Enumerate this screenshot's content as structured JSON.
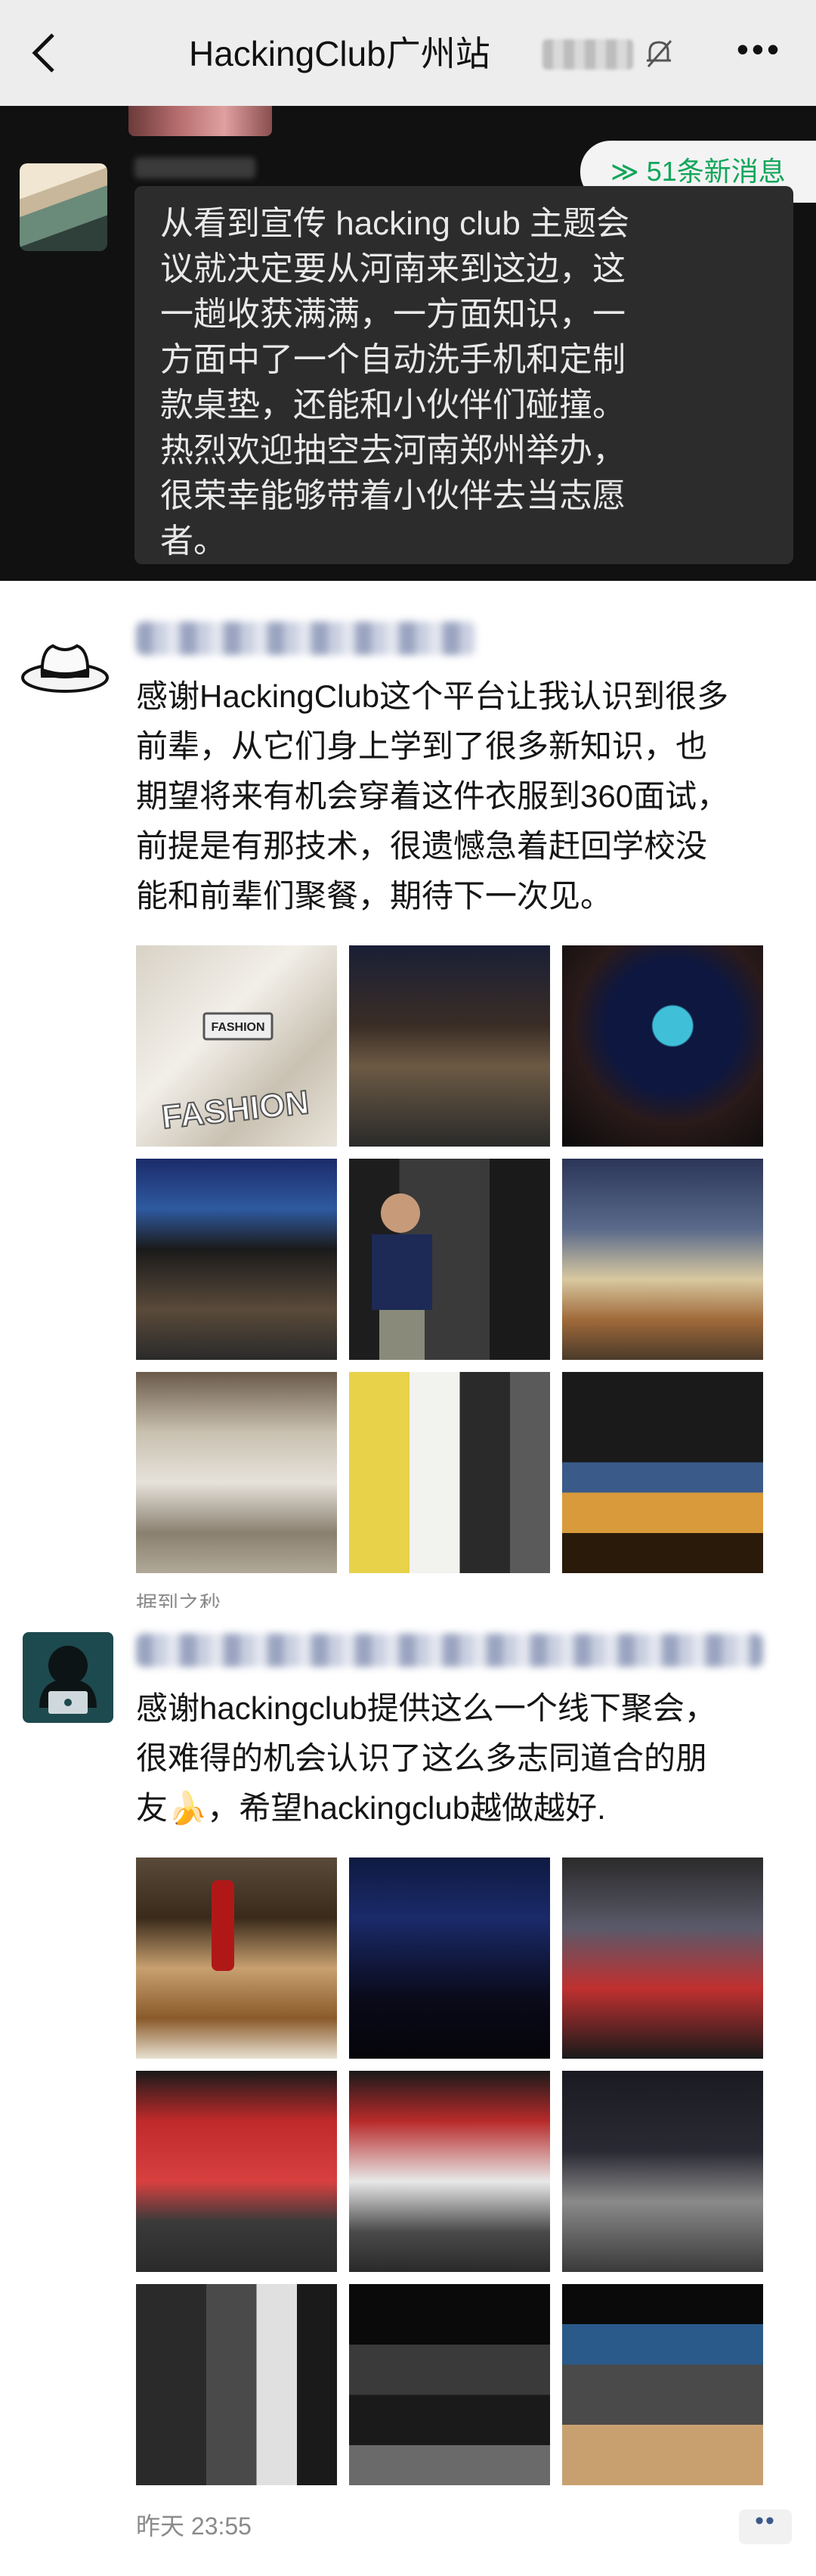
{
  "header": {
    "back_icon": "chevron-left-icon",
    "title": "HackingClub广州站",
    "mute_icon": "bell-off-icon",
    "more_label": "•••"
  },
  "chat": {
    "new_messages_arrow": "≫",
    "new_messages_label": "51条新消息",
    "message_lines": [
      "从看到宣传 hacking club 主题会",
      "议就决定要从河南来到这边，这",
      "一趟收获满满，一方面知识，一",
      "方面中了一个自动洗手机和定制",
      "款桌垫，还能和小伙伴们碰撞。",
      "热烈欢迎抽空去河南郑州举办，",
      "很荣幸能够带着小伙伴去当志愿",
      "者。"
    ]
  },
  "posts": [
    {
      "avatar_icon": "fedora-hat-icon",
      "text_lines": [
        "感谢HackingClub这个平台让我认识到很多",
        "前辈，从它们身上学到了很多新知识，也",
        "期望将来有机会穿着这件衣服到360面试，",
        "前提是有那技术，很遗憾急着赶回学校没",
        "能和前辈们聚餐，期待下一次见。"
      ],
      "tshirt_badge": "FASHION",
      "tshirt_print": "FASHION",
      "collapse_label": "据到之秒"
    },
    {
      "avatar_icon": "hacker-laptop-icon",
      "text_lines": [
        "感谢hackingclub提供这么一个线下聚会，",
        "很难得的机会认识了这么多志同道合的朋",
        "友🍌，希望hackingclub越做越好."
      ],
      "timestamp": "昨天 23:55",
      "comment_label": "••"
    }
  ],
  "colors": {
    "dark_background": "#111111",
    "bubble": "#2c2c2c",
    "new_messages_green": "#12a65a",
    "link_blue": "#3b5a8a"
  }
}
